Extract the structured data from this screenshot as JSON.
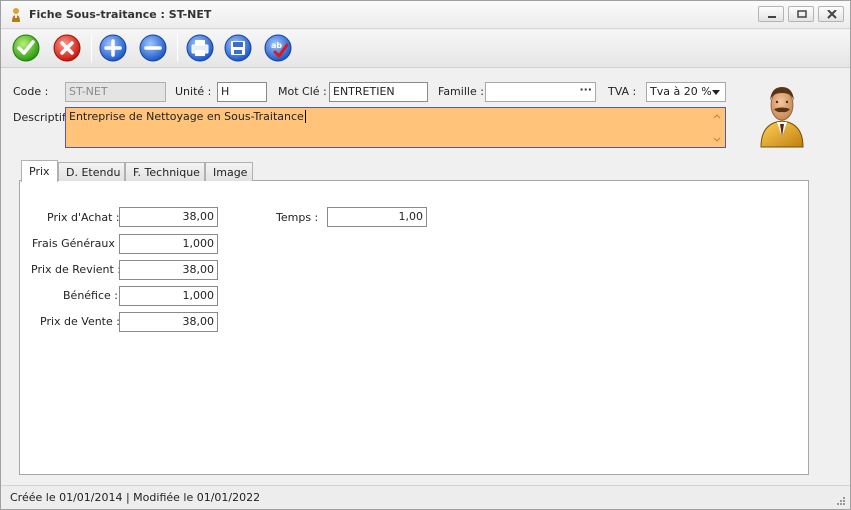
{
  "window": {
    "title": "Fiche Sous-traitance : ST-NET"
  },
  "toolbar": {
    "buttons": [
      "validate-icon",
      "cancel-icon",
      "add-icon",
      "remove-icon",
      "print-icon",
      "save-icon",
      "spellcheck-icon"
    ]
  },
  "form": {
    "code_label": "Code :",
    "code_value": "ST-NET",
    "unite_label": "Unité :",
    "unite_value": "H",
    "motcle_label": "Mot Clé :",
    "motcle_value": "ENTRETIEN",
    "famille_label": "Famille :",
    "famille_value": "",
    "famille_button": "···",
    "tva_label": "TVA :",
    "tva_value": "Tva à 20 %",
    "descriptif_label": "Descriptif :",
    "descriptif_value": "Entreprise de Nettoyage en Sous-Traitance",
    "descriptif_bg": "#ffc379"
  },
  "tabs": [
    {
      "label": "Prix",
      "active": true
    },
    {
      "label": "D. Etendu",
      "active": false
    },
    {
      "label": "F. Technique",
      "active": false
    },
    {
      "label": "Image",
      "active": false
    }
  ],
  "prix": {
    "achat_label": "Prix d'Achat :",
    "achat_value": "38,00",
    "frais_label": "Frais Généraux :",
    "frais_value": "1,000",
    "revient_label": "Prix de Revient :",
    "revient_value": "38,00",
    "benefice_label": "Bénéfice :",
    "benefice_value": "1,000",
    "vente_label": "Prix de Vente :",
    "vente_value": "38,00",
    "temps_label": "Temps :",
    "temps_value": "1,00"
  },
  "status": {
    "text": "Créée le 01/01/2014 | Modifiée le 01/01/2022"
  }
}
